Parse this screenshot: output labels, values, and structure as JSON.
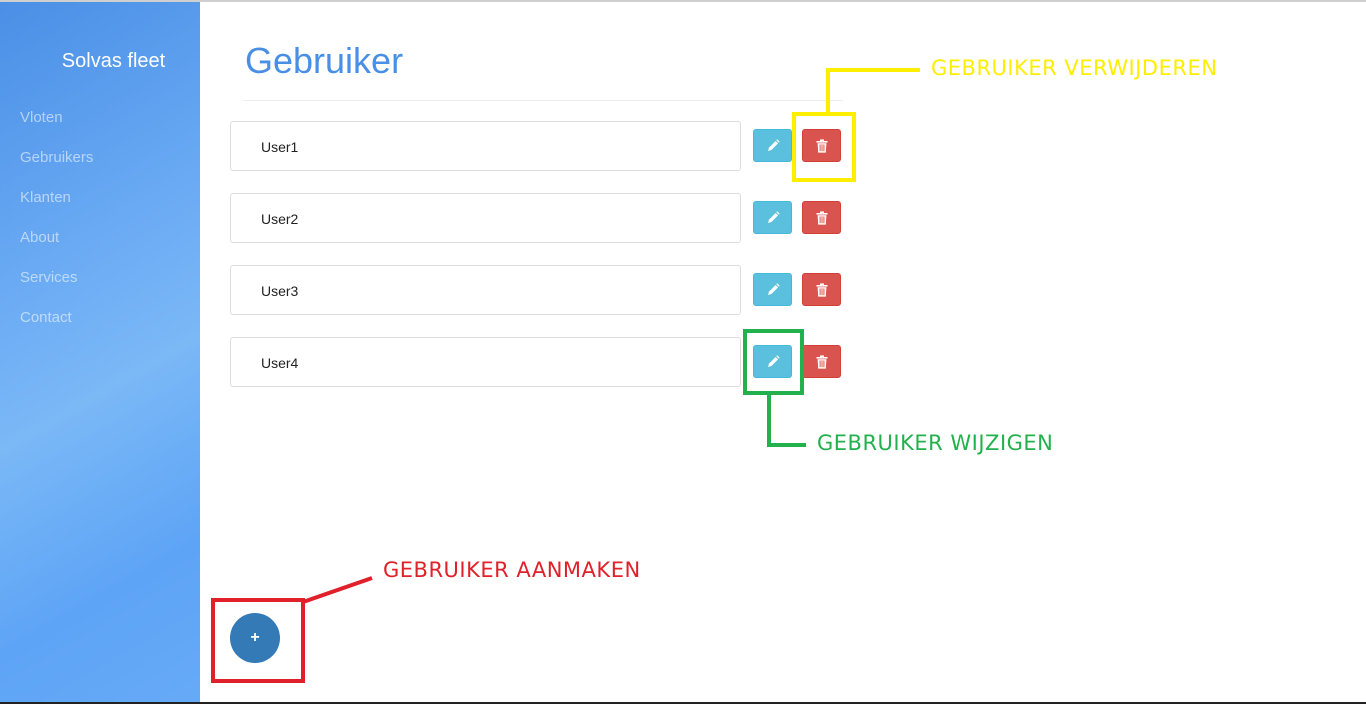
{
  "sidebar": {
    "brand": "Solvas fleet",
    "items": [
      {
        "label": "Vloten"
      },
      {
        "label": "Gebruikers"
      },
      {
        "label": "Klanten"
      },
      {
        "label": "About"
      },
      {
        "label": "Services"
      },
      {
        "label": "Contact"
      }
    ]
  },
  "main": {
    "title": "Gebruiker",
    "users": [
      {
        "name": "User1"
      },
      {
        "name": "User2"
      },
      {
        "name": "User3"
      },
      {
        "name": "User4"
      }
    ],
    "add_button_label": "+"
  },
  "annotations": {
    "delete": {
      "label": "GEBRUIKER VERWIJDEREN",
      "color": "#ffee00"
    },
    "edit": {
      "label": "GEBRUIKER WIJZIGEN",
      "color": "#22b14c"
    },
    "create": {
      "label": "GEBRUIKER AANMAKEN",
      "color": "#e0202a"
    }
  },
  "colors": {
    "accent": "#4a8fe6",
    "edit_button": "#5bc0de",
    "delete_button": "#d9534f",
    "fab": "#337ab7"
  },
  "icons": {
    "edit": "pencil-icon",
    "delete": "trash-icon"
  }
}
